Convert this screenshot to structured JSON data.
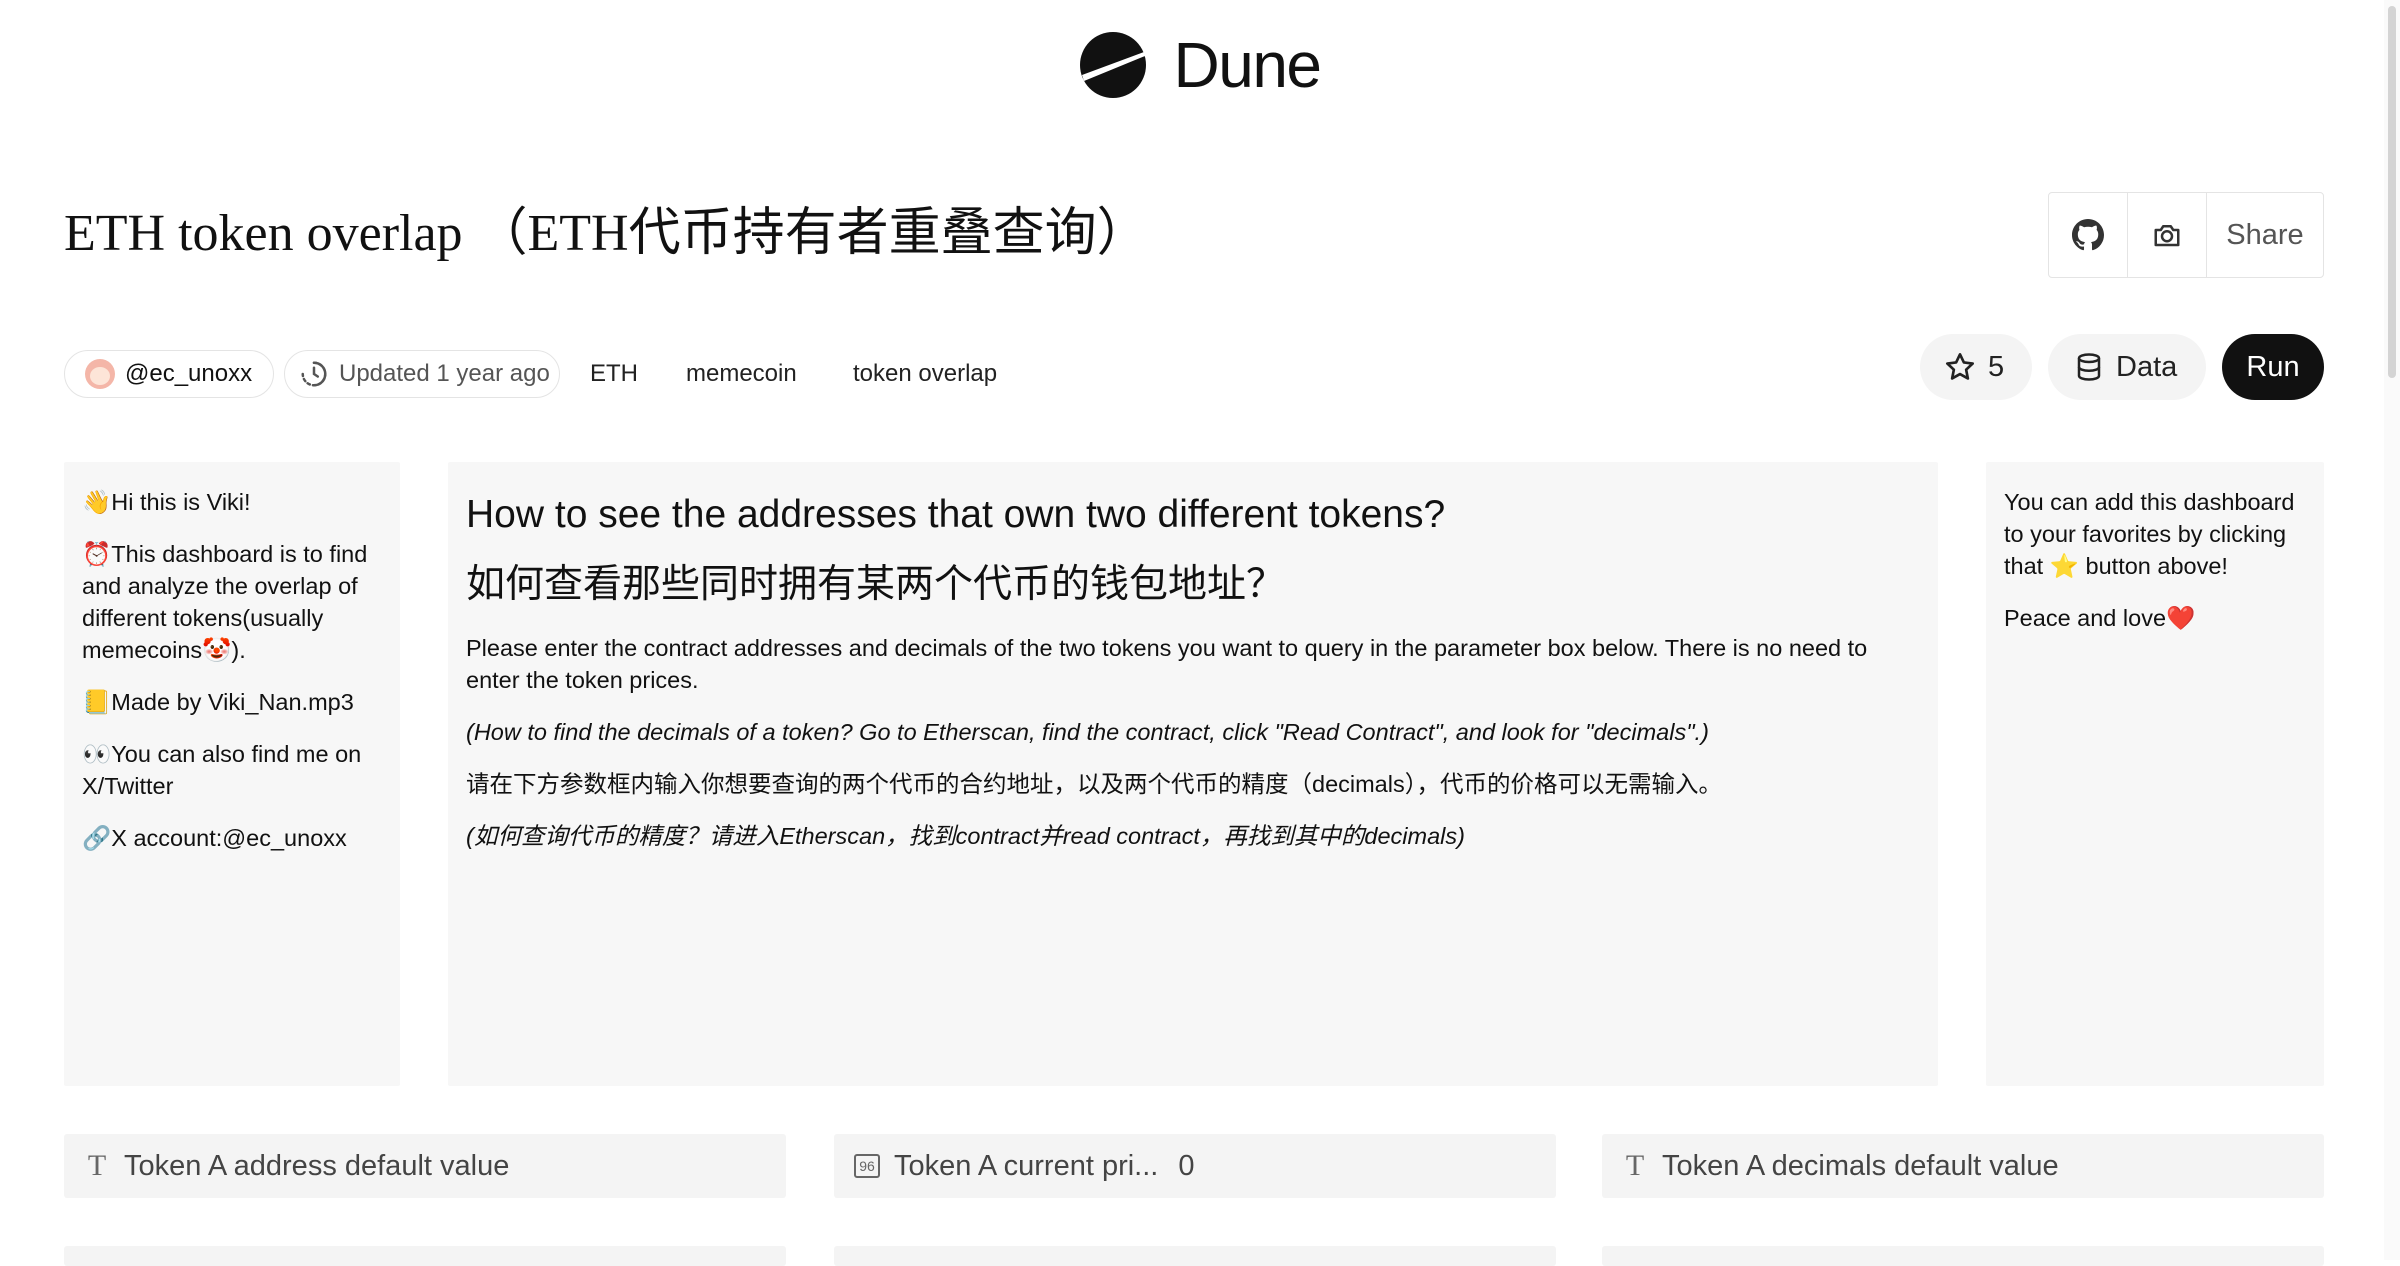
{
  "brand": {
    "name": "Dune",
    "logo_icon": "dune-logo-icon"
  },
  "dashboard": {
    "title": "ETH token overlap （ETH代币持有者重叠查询）",
    "author": "@ec_unoxx",
    "updated": "Updated 1 year ago",
    "tags": [
      "ETH",
      "memecoin",
      "token overlap"
    ],
    "stars": "5",
    "data_label": "Data",
    "run_label": "Run",
    "share_label": "Share"
  },
  "left_panel": {
    "lines": [
      {
        "emoji": "👋",
        "text": "Hi this is Viki!"
      },
      {
        "emoji": "⏰",
        "text": "This dashboard is to find and analyze the overlap of different tokens(usually memecoins"
      },
      {
        "emoji": "📒",
        "text": "Made by Viki_Nan.mp3"
      },
      {
        "emoji": "👀",
        "text": "You can also find me on X/Twitter"
      },
      {
        "emoji": "🔗",
        "text": "X account:@ec_unoxx"
      }
    ],
    "clown_emoji": "🤡",
    "suffix": ")."
  },
  "main_panel": {
    "heading_en": "How to see the addresses that own two different tokens?",
    "heading_zh": "如何查看那些同时拥有某两个代币的钱包地址？",
    "para_en": "Please enter the contract addresses and decimals of the two tokens you want to query in the parameter box below. There is no need to enter the token prices.",
    "note_en": "(How to find the decimals of a token? Go to Etherscan, find the contract, click \"Read Contract\", and look for \"decimals\".)",
    "para_zh": "请在下方参数框内输入你想要查询的两个代币的合约地址，以及两个代币的精度（decimals），代币的价格可以无需输入。",
    "note_zh": "(如何查询代币的精度？请进入Etherscan，找到contract并read contract，再找到其中的decimals)"
  },
  "right_panel": {
    "text_before_star": "You can add this dashboard to your favorites by clicking that",
    "star_emoji": "⭐",
    "text_after_star": "button above!",
    "closing": "Peace and love",
    "heart_emoji": "❤️"
  },
  "params": [
    {
      "icon": "text-type-icon",
      "glyph": "T",
      "label": "Token A address default value",
      "value": ""
    },
    {
      "icon": "number-type-icon",
      "glyph": "96",
      "label": "Token A current pri...",
      "value": "0"
    },
    {
      "icon": "text-type-icon",
      "glyph": "T",
      "label": "Token A decimals default value",
      "value": ""
    }
  ]
}
